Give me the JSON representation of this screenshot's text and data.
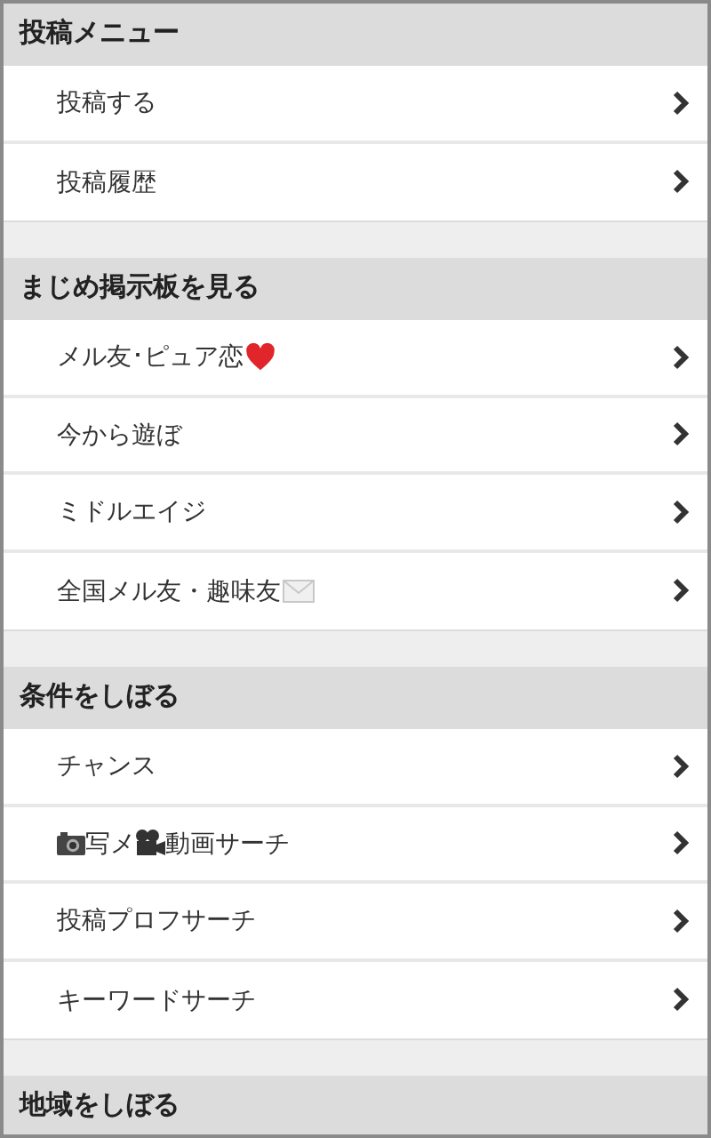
{
  "sections": [
    {
      "title": "投稿メニュー",
      "items": [
        {
          "label": "投稿する"
        },
        {
          "label": "投稿履歴"
        }
      ]
    },
    {
      "title": "まじめ掲示板を見る",
      "items": [
        {
          "label": "メル友･ピュア恋"
        },
        {
          "label": "今から遊ぼ"
        },
        {
          "label": "ミドルエイジ"
        },
        {
          "label": "全国メル友・趣味友"
        }
      ]
    },
    {
      "title": "条件をしぼる",
      "items": [
        {
          "label": "チャンス"
        },
        {
          "label": "写メ",
          "label_2": "動画サーチ"
        },
        {
          "label": "投稿プロフサーチ"
        },
        {
          "label": "キーワードサーチ"
        }
      ]
    },
    {
      "title": "地域をしぼる"
    }
  ]
}
